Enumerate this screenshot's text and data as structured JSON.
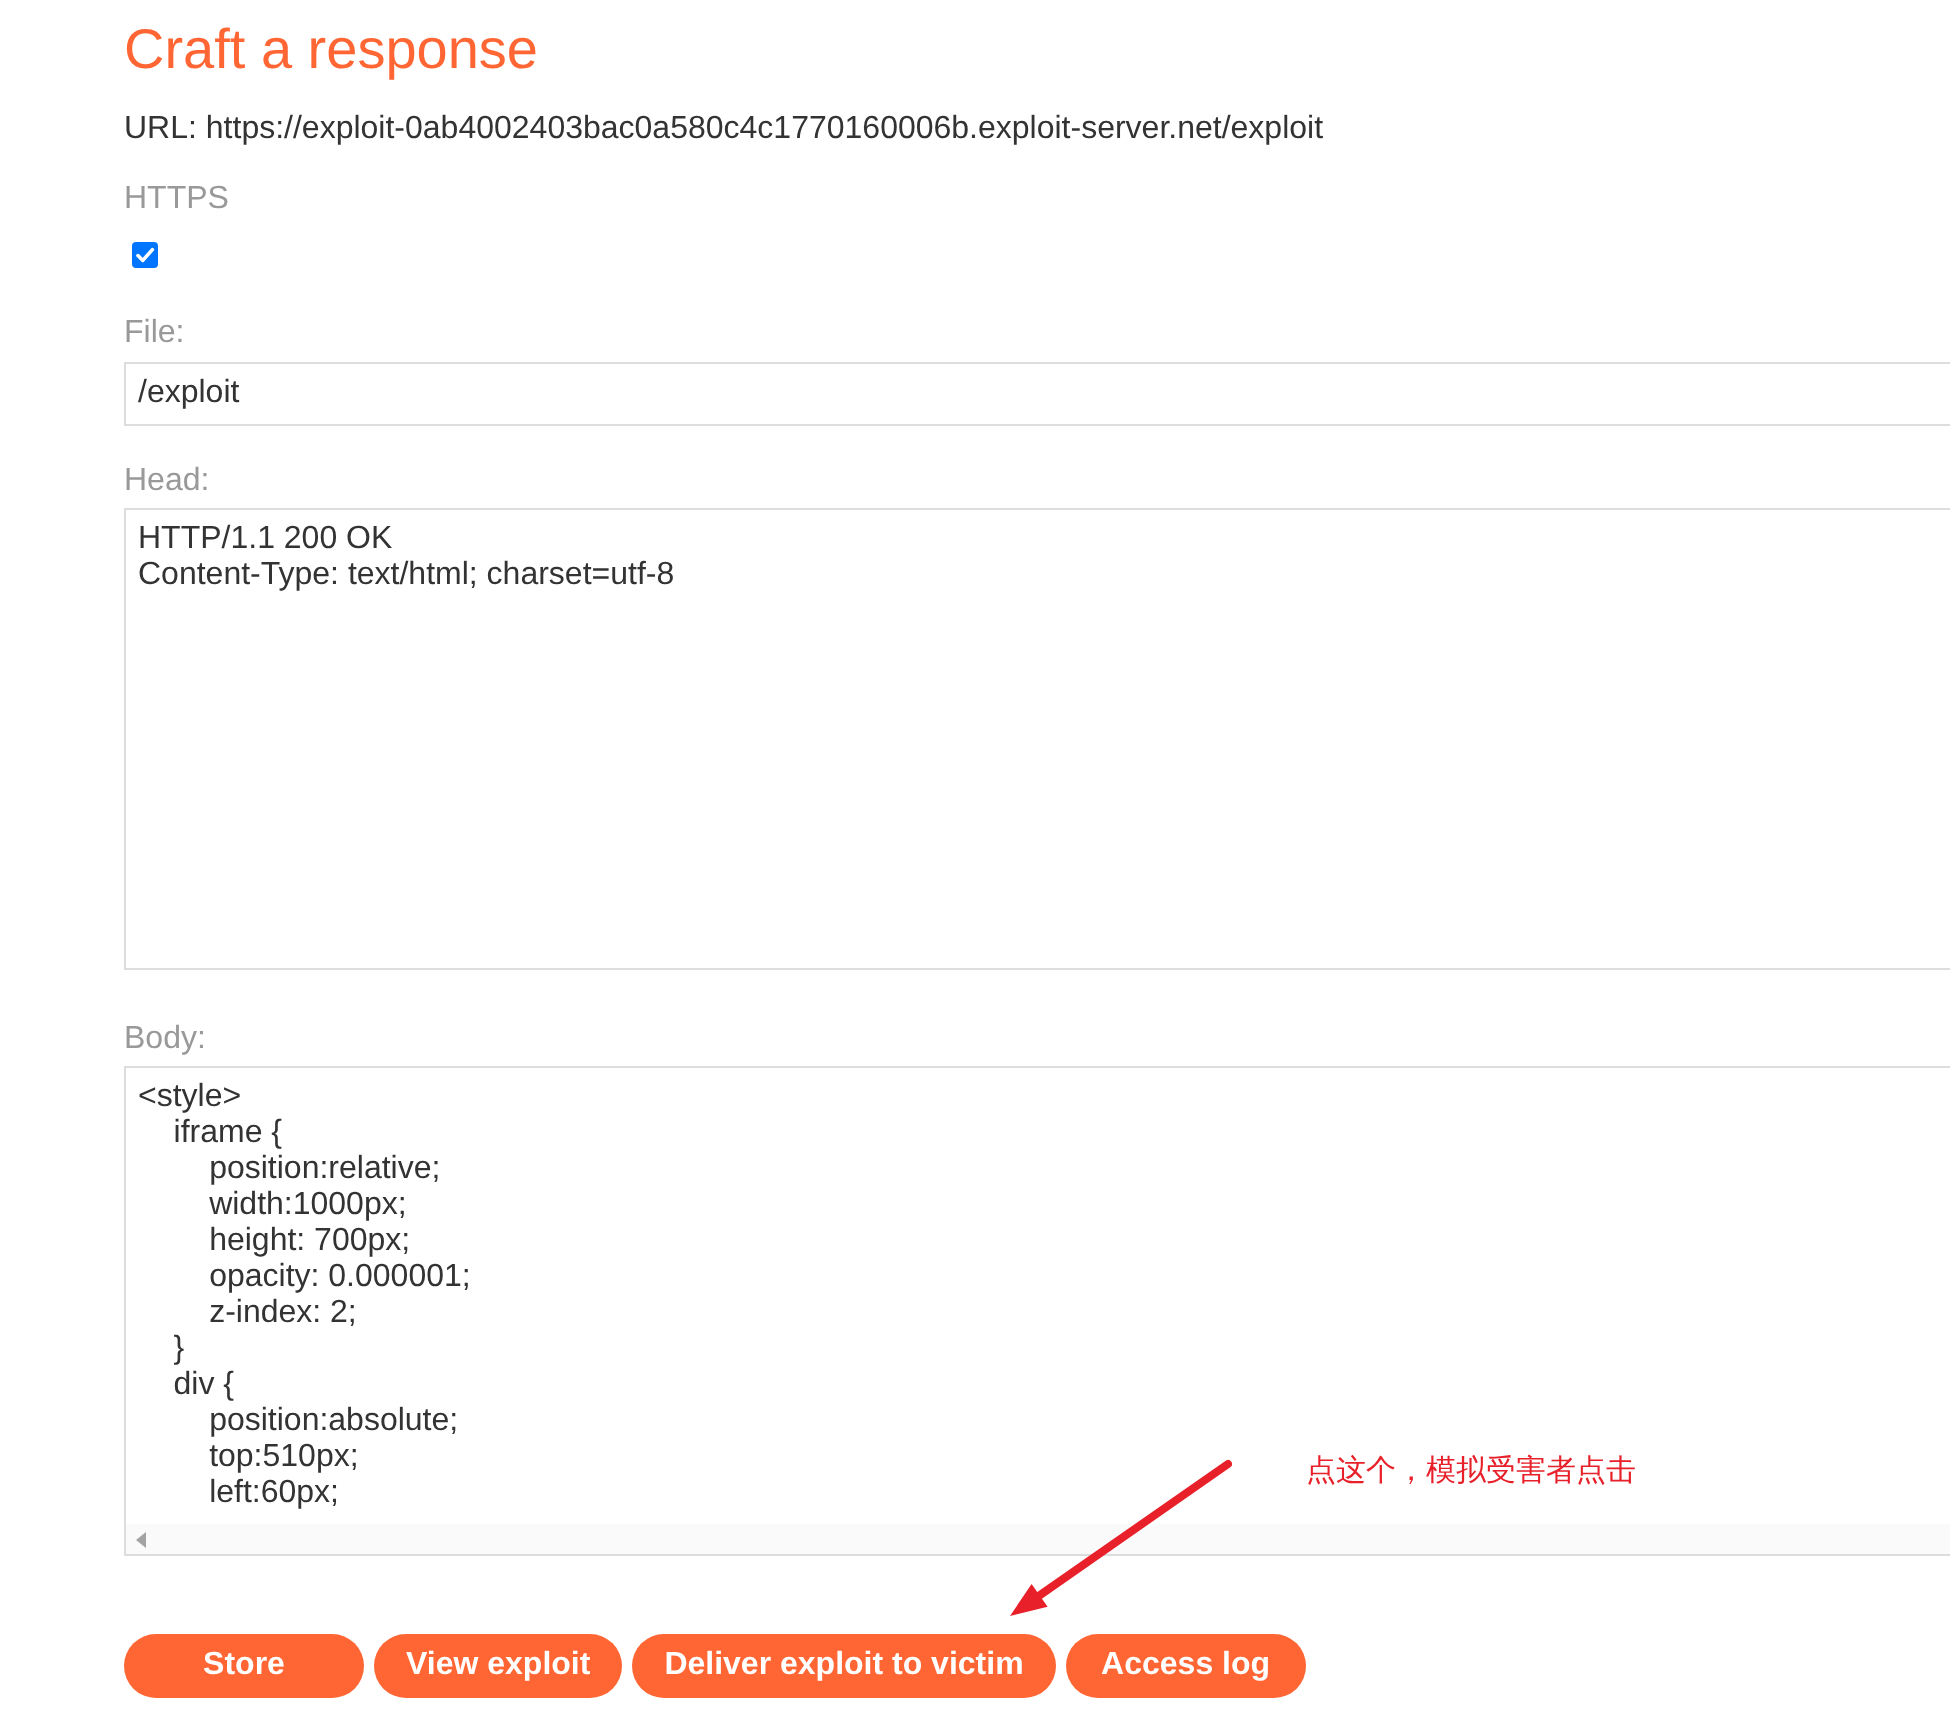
{
  "title": "Craft a response",
  "url": "URL: https://exploit-0ab4002403bac0a580c4c1770160006b.exploit-server.net/exploit",
  "form": {
    "https": {
      "label": "HTTPS",
      "checked": true
    },
    "file": {
      "label": "File:",
      "value": "/exploit"
    },
    "head": {
      "label": "Head:",
      "value": "HTTP/1.1 200 OK\nContent-Type: text/html; charset=utf-8"
    },
    "body": {
      "label": "Body:",
      "value": "<style>\n    iframe {\n        position:relative;\n        width:1000px;\n        height: 700px;\n        opacity: 0.000001;\n        z-index: 2;\n    }\n    div {\n        position:absolute;\n        top:510px;\n        left:60px;"
    }
  },
  "buttons": [
    {
      "label": "Store"
    },
    {
      "label": "View exploit"
    },
    {
      "label": "Deliver exploit to victim"
    },
    {
      "label": "Access log"
    }
  ],
  "annotation": {
    "text": "点这个，模拟受害者点击"
  }
}
